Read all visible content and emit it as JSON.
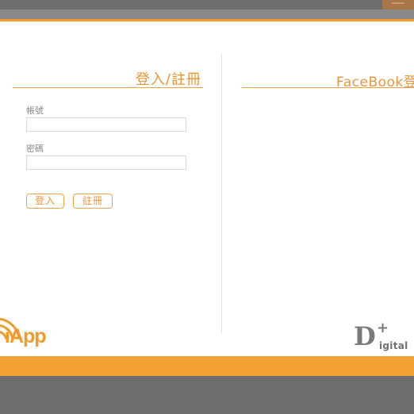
{
  "login": {
    "title": "登入/註冊",
    "account_label": "帳號",
    "account_value": "",
    "password_label": "密碼",
    "password_value": "",
    "login_button": "登入",
    "register_button": "註冊"
  },
  "facebook": {
    "title": "FaceBook登"
  },
  "branding": {
    "app_logo_text": "iApp",
    "d_letter": "D",
    "plus_mark": "+",
    "digital_text": "igital"
  },
  "colors": {
    "accent": "#f39a2a",
    "accent_light": "#f5a234",
    "frame_gray": "#6e6e6e",
    "logo_gray": "#7a7a7a"
  },
  "icons": {
    "app_logo": "wifi-signal-icon",
    "window_control": "minimize-icon"
  }
}
